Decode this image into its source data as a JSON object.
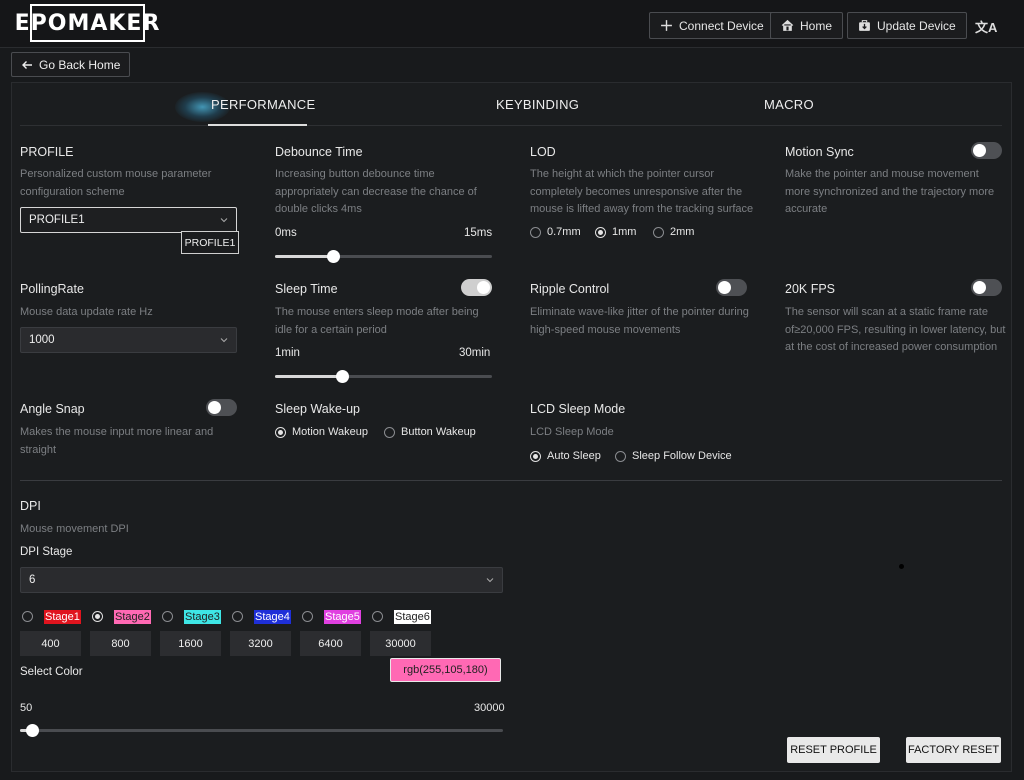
{
  "header": {
    "logo_text": "EPOMAKER",
    "connect_label": "Connect Device",
    "home_label": "Home",
    "update_label": "Update Device",
    "lang_glyph": "文A"
  },
  "back_label": "Go Back Home",
  "tabs": {
    "performance": "PERFORMANCE",
    "keybinding": "KEYBINDING",
    "macro": "MACRO",
    "active": "PERFORMANCE"
  },
  "profile": {
    "title": "PROFILE",
    "desc": "Personalized custom mouse parameter configuration scheme",
    "value": "PROFILE1",
    "tooltip": "PROFILE1"
  },
  "debounce": {
    "title": "Debounce Time",
    "desc": "Increasing button debounce time appropriately can decrease the chance of double clicks 4ms",
    "min_label": "0ms",
    "max_label": "15ms",
    "min": 0,
    "max": 15,
    "value": 4
  },
  "lod": {
    "title": "LOD",
    "desc": "The height at which the pointer cursor completely becomes unresponsive after the mouse is lifted away from the tracking surface",
    "options": [
      "0.7mm",
      "1mm",
      "2mm"
    ],
    "selected": "1mm"
  },
  "motion_sync": {
    "title": "Motion Sync",
    "desc": "Make the pointer and mouse movement more synchronized and the trajectory more accurate",
    "enabled": false
  },
  "polling": {
    "title": "PollingRate",
    "desc": "Mouse data update rate Hz",
    "value": "1000"
  },
  "sleep_time": {
    "title": "Sleep Time",
    "desc": "The mouse enters sleep mode after being idle for a certain period",
    "enabled": true,
    "min_label": "1min",
    "max_label": "30min",
    "min": 1,
    "max": 30,
    "value": 10
  },
  "ripple": {
    "title": "Ripple Control",
    "desc": "Eliminate wave-like jitter of the pointer during high-speed mouse movements",
    "enabled": false
  },
  "fps20k": {
    "title": "20K FPS",
    "desc": "The sensor will scan at a static frame rate of≥20,000 FPS, resulting in lower latency, but at the cost of increased power consumption",
    "enabled": false
  },
  "angle_snap": {
    "title": "Angle Snap",
    "desc": "Makes the mouse input more linear and straight",
    "enabled": false
  },
  "sleep_wakeup": {
    "title": "Sleep Wake-up",
    "options": [
      "Motion Wakeup",
      "Button Wakeup"
    ],
    "selected": "Motion Wakeup"
  },
  "lcd_sleep": {
    "title": "LCD Sleep Mode",
    "desc": "LCD Sleep Mode",
    "options": [
      "Auto Sleep",
      "Sleep Follow Device"
    ],
    "selected": "Auto Sleep"
  },
  "dpi": {
    "title": "DPI",
    "desc": "Mouse movement DPI",
    "stage_label": "DPI Stage",
    "stage_value": "6",
    "stages": [
      {
        "name": "Stage1",
        "value": "400",
        "color": "#e0141e",
        "text_color": "#ffffff"
      },
      {
        "name": "Stage2",
        "value": "800",
        "color": "#ff69b4",
        "text_color": "#222222"
      },
      {
        "name": "Stage3",
        "value": "1600",
        "color": "#3ee6e6",
        "text_color": "#222222"
      },
      {
        "name": "Stage4",
        "value": "3200",
        "color": "#1e2fd8",
        "text_color": "#ffffff"
      },
      {
        "name": "Stage5",
        "value": "6400",
        "color": "#e040e0",
        "text_color": "#ffffff"
      },
      {
        "name": "Stage6",
        "value": "30000",
        "color": "#ffffff",
        "text_color": "#222222"
      }
    ],
    "selected_stage": 1,
    "select_color_label": "Select Color",
    "color_value": "rgb(255,105,180)",
    "color_hex": "#ff69b4",
    "slider_min_label": "50",
    "slider_max_label": "30000",
    "slider_min": 50,
    "slider_max": 30000,
    "slider_value": 800
  },
  "buttons": {
    "reset_profile": "RESET PROFILE",
    "factory_reset": "FACTORY RESET"
  }
}
